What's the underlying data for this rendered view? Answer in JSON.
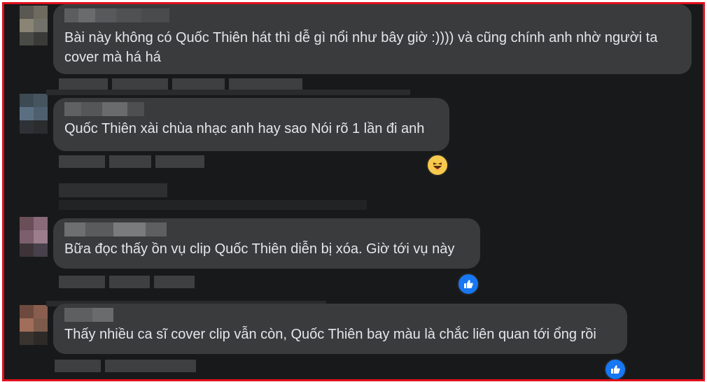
{
  "comments": [
    {
      "text": "Bài này không có Quốc Thiên hát thì dễ gì nổi như bây giờ :)))) và cũng chính anh nhờ người ta\ncover mà há há",
      "reaction": ""
    },
    {
      "text": "Quốc Thiên xài chùa nhạc anh hay sao Nói rõ 1 lần đi anh",
      "reaction": "haha-icon"
    },
    {
      "text": "Bữa đọc thấy ồn vụ clip Quốc Thiên diễn bị xóa. Giờ tới vụ này",
      "reaction": "like-icon"
    },
    {
      "text": "Thấy nhiều ca sĩ cover clip vẫn còn, Quốc Thiên bay màu là chắc liên quan tới ổng rồi",
      "reaction": "like-icon"
    }
  ],
  "colors": {
    "frame_border": "#e0101c",
    "background": "#18191a",
    "bubble": "#3a3b3c",
    "text": "#e4e6eb",
    "like": "#1877f2"
  }
}
